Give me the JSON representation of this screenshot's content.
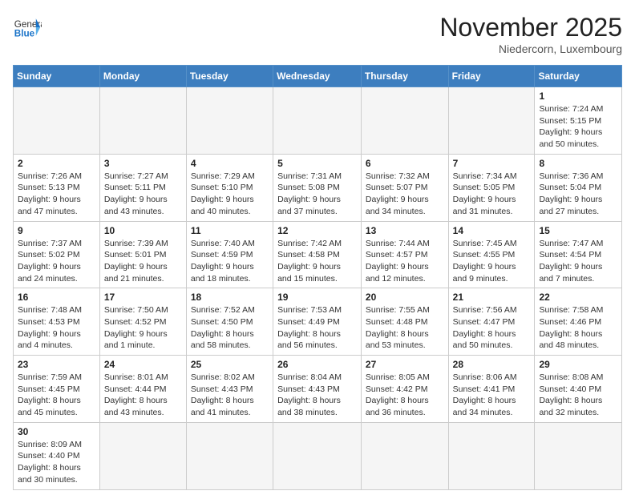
{
  "header": {
    "logo_general": "General",
    "logo_blue": "Blue",
    "month_title": "November 2025",
    "location": "Niedercorn, Luxembourg"
  },
  "days_of_week": [
    "Sunday",
    "Monday",
    "Tuesday",
    "Wednesday",
    "Thursday",
    "Friday",
    "Saturday"
  ],
  "weeks": [
    [
      {
        "day": "",
        "info": ""
      },
      {
        "day": "",
        "info": ""
      },
      {
        "day": "",
        "info": ""
      },
      {
        "day": "",
        "info": ""
      },
      {
        "day": "",
        "info": ""
      },
      {
        "day": "",
        "info": ""
      },
      {
        "day": "1",
        "info": "Sunrise: 7:24 AM\nSunset: 5:15 PM\nDaylight: 9 hours and 50 minutes."
      }
    ],
    [
      {
        "day": "2",
        "info": "Sunrise: 7:26 AM\nSunset: 5:13 PM\nDaylight: 9 hours and 47 minutes."
      },
      {
        "day": "3",
        "info": "Sunrise: 7:27 AM\nSunset: 5:11 PM\nDaylight: 9 hours and 43 minutes."
      },
      {
        "day": "4",
        "info": "Sunrise: 7:29 AM\nSunset: 5:10 PM\nDaylight: 9 hours and 40 minutes."
      },
      {
        "day": "5",
        "info": "Sunrise: 7:31 AM\nSunset: 5:08 PM\nDaylight: 9 hours and 37 minutes."
      },
      {
        "day": "6",
        "info": "Sunrise: 7:32 AM\nSunset: 5:07 PM\nDaylight: 9 hours and 34 minutes."
      },
      {
        "day": "7",
        "info": "Sunrise: 7:34 AM\nSunset: 5:05 PM\nDaylight: 9 hours and 31 minutes."
      },
      {
        "day": "8",
        "info": "Sunrise: 7:36 AM\nSunset: 5:04 PM\nDaylight: 9 hours and 27 minutes."
      }
    ],
    [
      {
        "day": "9",
        "info": "Sunrise: 7:37 AM\nSunset: 5:02 PM\nDaylight: 9 hours and 24 minutes."
      },
      {
        "day": "10",
        "info": "Sunrise: 7:39 AM\nSunset: 5:01 PM\nDaylight: 9 hours and 21 minutes."
      },
      {
        "day": "11",
        "info": "Sunrise: 7:40 AM\nSunset: 4:59 PM\nDaylight: 9 hours and 18 minutes."
      },
      {
        "day": "12",
        "info": "Sunrise: 7:42 AM\nSunset: 4:58 PM\nDaylight: 9 hours and 15 minutes."
      },
      {
        "day": "13",
        "info": "Sunrise: 7:44 AM\nSunset: 4:57 PM\nDaylight: 9 hours and 12 minutes."
      },
      {
        "day": "14",
        "info": "Sunrise: 7:45 AM\nSunset: 4:55 PM\nDaylight: 9 hours and 9 minutes."
      },
      {
        "day": "15",
        "info": "Sunrise: 7:47 AM\nSunset: 4:54 PM\nDaylight: 9 hours and 7 minutes."
      }
    ],
    [
      {
        "day": "16",
        "info": "Sunrise: 7:48 AM\nSunset: 4:53 PM\nDaylight: 9 hours and 4 minutes."
      },
      {
        "day": "17",
        "info": "Sunrise: 7:50 AM\nSunset: 4:52 PM\nDaylight: 9 hours and 1 minute."
      },
      {
        "day": "18",
        "info": "Sunrise: 7:52 AM\nSunset: 4:50 PM\nDaylight: 8 hours and 58 minutes."
      },
      {
        "day": "19",
        "info": "Sunrise: 7:53 AM\nSunset: 4:49 PM\nDaylight: 8 hours and 56 minutes."
      },
      {
        "day": "20",
        "info": "Sunrise: 7:55 AM\nSunset: 4:48 PM\nDaylight: 8 hours and 53 minutes."
      },
      {
        "day": "21",
        "info": "Sunrise: 7:56 AM\nSunset: 4:47 PM\nDaylight: 8 hours and 50 minutes."
      },
      {
        "day": "22",
        "info": "Sunrise: 7:58 AM\nSunset: 4:46 PM\nDaylight: 8 hours and 48 minutes."
      }
    ],
    [
      {
        "day": "23",
        "info": "Sunrise: 7:59 AM\nSunset: 4:45 PM\nDaylight: 8 hours and 45 minutes."
      },
      {
        "day": "24",
        "info": "Sunrise: 8:01 AM\nSunset: 4:44 PM\nDaylight: 8 hours and 43 minutes."
      },
      {
        "day": "25",
        "info": "Sunrise: 8:02 AM\nSunset: 4:43 PM\nDaylight: 8 hours and 41 minutes."
      },
      {
        "day": "26",
        "info": "Sunrise: 8:04 AM\nSunset: 4:43 PM\nDaylight: 8 hours and 38 minutes."
      },
      {
        "day": "27",
        "info": "Sunrise: 8:05 AM\nSunset: 4:42 PM\nDaylight: 8 hours and 36 minutes."
      },
      {
        "day": "28",
        "info": "Sunrise: 8:06 AM\nSunset: 4:41 PM\nDaylight: 8 hours and 34 minutes."
      },
      {
        "day": "29",
        "info": "Sunrise: 8:08 AM\nSunset: 4:40 PM\nDaylight: 8 hours and 32 minutes."
      }
    ],
    [
      {
        "day": "30",
        "info": "Sunrise: 8:09 AM\nSunset: 4:40 PM\nDaylight: 8 hours and 30 minutes."
      },
      {
        "day": "",
        "info": ""
      },
      {
        "day": "",
        "info": ""
      },
      {
        "day": "",
        "info": ""
      },
      {
        "day": "",
        "info": ""
      },
      {
        "day": "",
        "info": ""
      },
      {
        "day": "",
        "info": ""
      }
    ]
  ]
}
